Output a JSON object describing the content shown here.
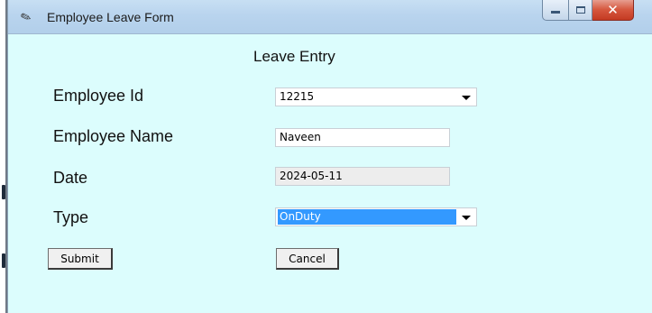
{
  "window": {
    "title": "Employee Leave Form",
    "controls": {
      "minimize": "minimize",
      "maximize": "maximize",
      "close": "✕"
    }
  },
  "form": {
    "heading": "Leave Entry",
    "employee_id": {
      "label": "Employee Id",
      "value": "12215"
    },
    "employee_name": {
      "label": "Employee Name",
      "value": "Naveen"
    },
    "date": {
      "label": "Date",
      "value": "2024-05-11"
    },
    "type": {
      "label": "Type",
      "value": "OnDuty"
    }
  },
  "buttons": {
    "submit": "Submit",
    "cancel": "Cancel"
  },
  "icons": {
    "app": "feather-icon",
    "dropdown": "chevron-down-icon"
  },
  "colors": {
    "background": "#dcfdfd",
    "selection": "#3399ff",
    "close_button": "#c43a22"
  }
}
